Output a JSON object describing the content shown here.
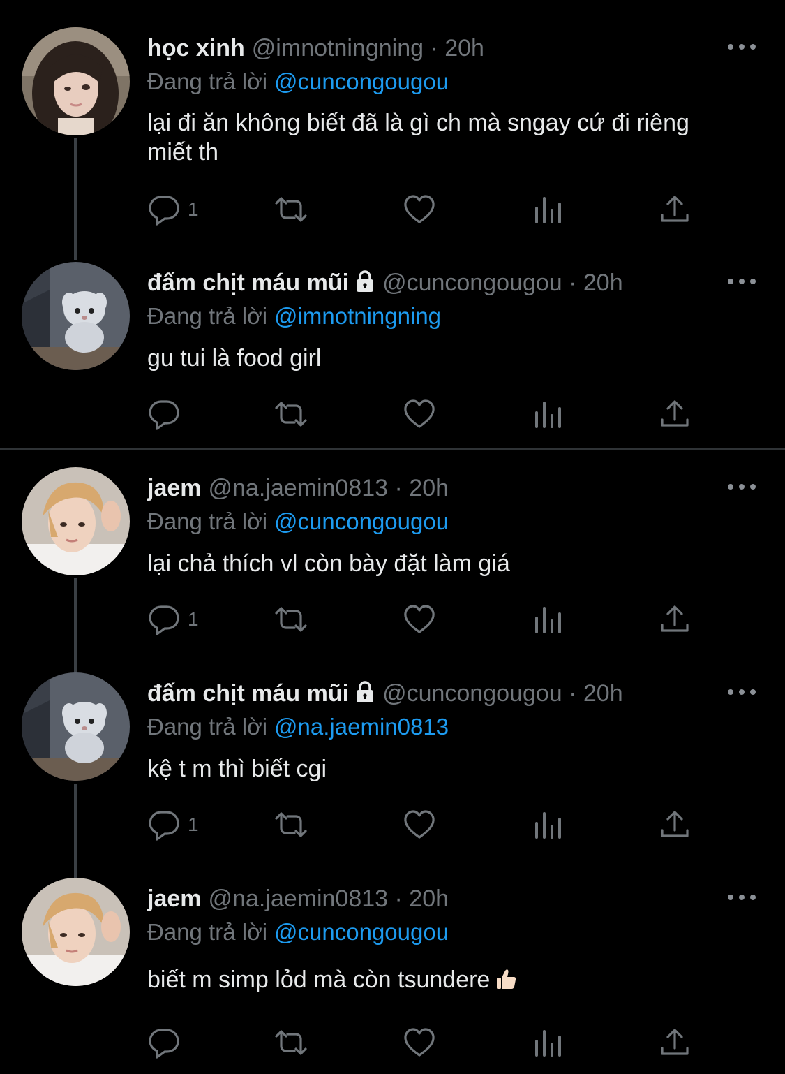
{
  "colors": {
    "background": "#000000",
    "text_primary": "#e7e9ea",
    "text_secondary": "#71767b",
    "mention": "#1d9bf0",
    "divider": "#2f3336"
  },
  "icons": {
    "reply": "reply-icon",
    "retweet": "retweet-icon",
    "like": "heart-icon",
    "analytics": "analytics-icon",
    "share": "share-icon",
    "more": "more-options-icon",
    "protected": "lock-icon"
  },
  "tweets": [
    {
      "name": "học xinh",
      "handle": "@imnotningning",
      "time": "· 20h",
      "reply_prefix": "Đang trả lời",
      "reply_mention": "@imnotningning",
      "reply_to": "@cuncongougou",
      "text": "lại đi ăn không biết đã là gì ch mà sngay cứ đi riêng miết th",
      "reply_count": "1",
      "protected": false
    },
    {
      "name": "đấm chịt máu mũi",
      "handle": "@cuncongougou",
      "time": "· 20h",
      "reply_prefix": "Đang trả lời",
      "reply_to": "@imnotningning",
      "text": "gu tui là food girl",
      "reply_count": "",
      "protected": true
    },
    {
      "name": "jaem",
      "handle": "@na.jaemin0813",
      "time": "· 20h",
      "reply_prefix": "Đang trả lời",
      "reply_to": "@cuncongougou",
      "text": "lại chả thích vl còn bày đặt làm giá",
      "reply_count": "1",
      "protected": false
    },
    {
      "name": "đấm chịt máu mũi",
      "handle": "@cuncongougou",
      "time": "· 20h",
      "reply_prefix": "Đang trả lời",
      "reply_to": "@na.jaemin0813",
      "text": "kệ t m thì biết cgi",
      "reply_count": "1",
      "protected": true
    },
    {
      "name": "jaem",
      "handle": "@na.jaemin0813",
      "time": "· 20h",
      "reply_prefix": "Đang trả lời",
      "reply_to": "@cuncongougou",
      "text": "biết m simp lỏd mà còn tsundere",
      "emoji": "thumbs-up-emoji",
      "reply_count": "",
      "protected": false
    }
  ]
}
